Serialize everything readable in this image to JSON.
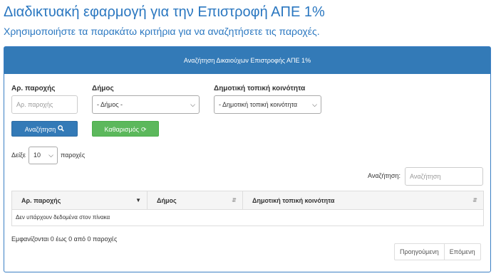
{
  "header": {
    "title": "Διαδικτυακή εφαρμογή για την Επιστροφή ΑΠΕ 1%",
    "subtitle": "Χρησιμοποιήστε τα παρακάτω κριτήρια για να αναζητήσετε τις παροχές."
  },
  "panel": {
    "heading": "Αναζήτηση Δικαιούχων Επιστροφής ΑΠΕ 1%"
  },
  "filters": {
    "supply_label": "Αρ. παροχής",
    "supply_placeholder": "Αρ. παροχής",
    "municipality_label": "Δήμος",
    "municipality_value": "- Δήμος -",
    "community_label": "Δημοτική τοπική κοινότητα",
    "community_value": "- Δημοτική τοπική κοινότητα"
  },
  "buttons": {
    "search_label": "Αναζήτηση",
    "reset_label": "Καθαρισμός"
  },
  "length": {
    "prefix": "Δείξε",
    "value": "10",
    "suffix": "παροχές"
  },
  "table_search": {
    "label": "Αναζήτηση:",
    "placeholder": "Αναζήτηση"
  },
  "table": {
    "columns": [
      "Αρ. παροχής",
      "Δήμος",
      "Δημοτική τοπική κοινότητα"
    ],
    "empty_message": "Δεν υπάρχουν δεδομένα στον πίνακα"
  },
  "info": "Εμφανίζονται 0 έως 0 από 0 παροχές",
  "pagination": {
    "previous": "Προηγούμενη",
    "next": "Επόμενη"
  },
  "colors": {
    "primary": "#337ab7",
    "success": "#5cb85c",
    "title": "#2a77c0"
  }
}
